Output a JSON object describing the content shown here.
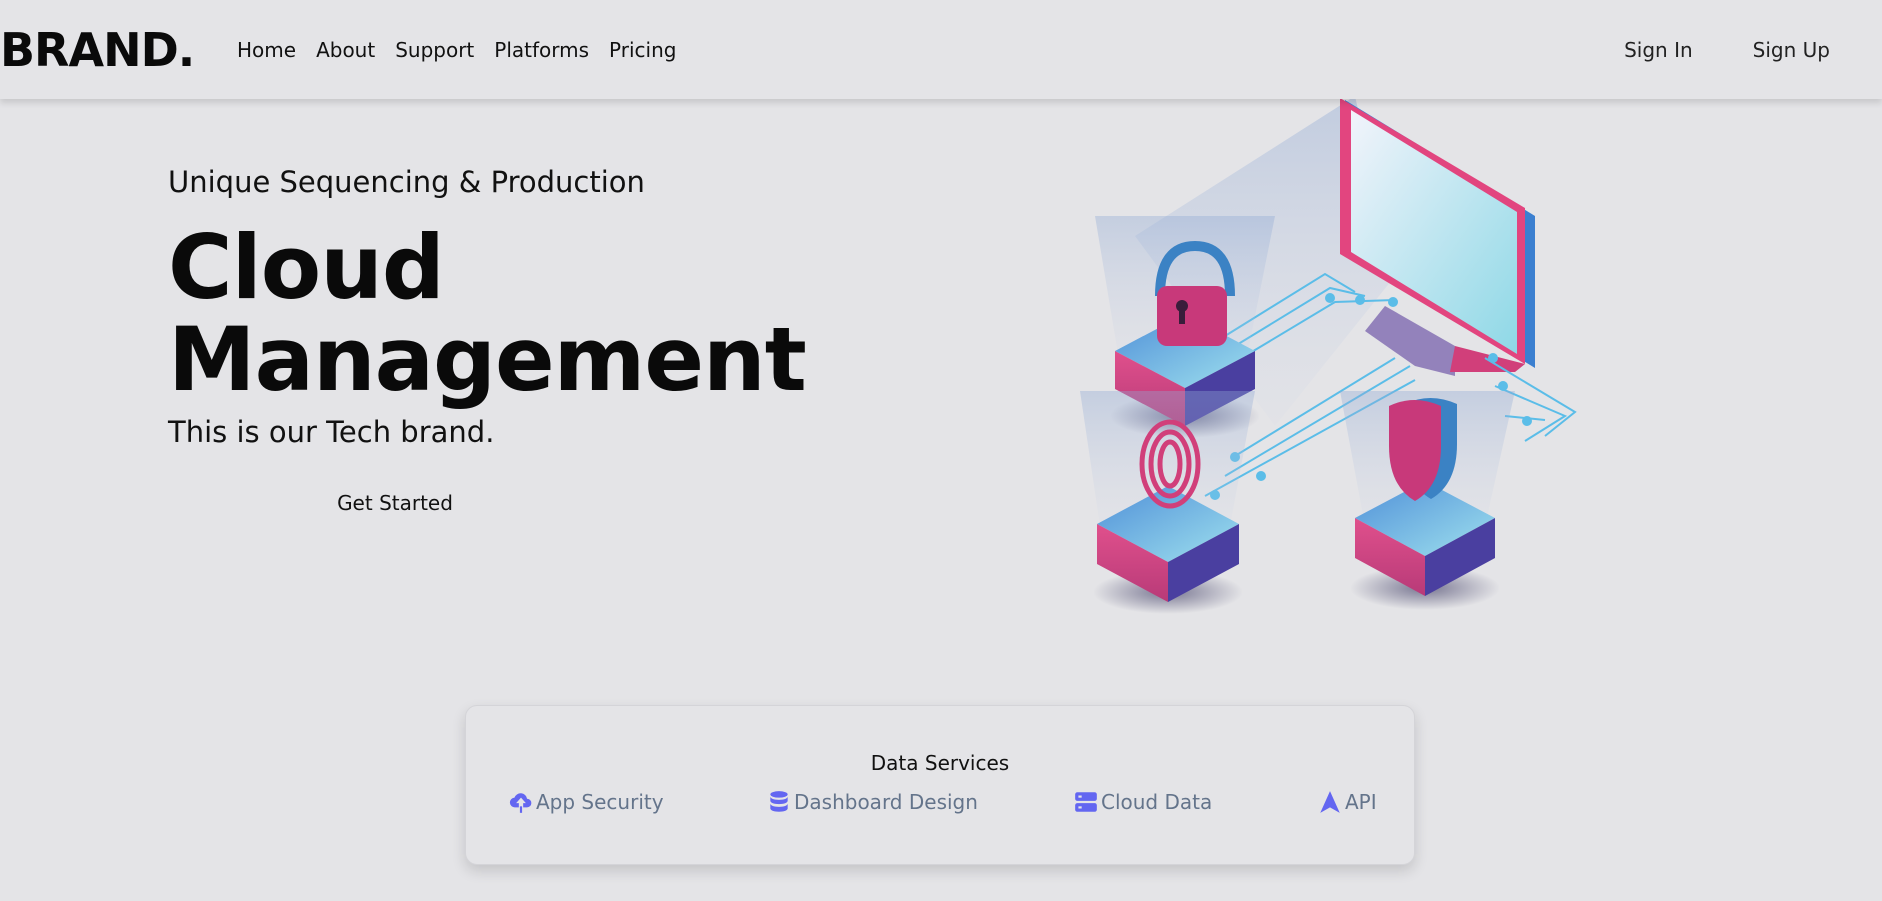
{
  "brand": "BRAND.",
  "nav": {
    "items": [
      {
        "label": "Home"
      },
      {
        "label": "About"
      },
      {
        "label": "Support"
      },
      {
        "label": "Platforms"
      },
      {
        "label": "Pricing"
      }
    ]
  },
  "auth": {
    "sign_in": "Sign In",
    "sign_up": "Sign Up"
  },
  "hero": {
    "eyebrow": "Unique Sequencing & Production",
    "headline_line1": "Cloud",
    "headline_line2": "Management",
    "tagline": "This is our Tech brand.",
    "cta": "Get Started"
  },
  "services": {
    "title": "Data Services",
    "items": [
      {
        "label": "App Security",
        "icon": "cloud-upload-icon"
      },
      {
        "label": "Dashboard Design",
        "icon": "database-icon"
      },
      {
        "label": "Cloud Data",
        "icon": "server-icon"
      },
      {
        "label": "API",
        "icon": "navigation-arrow-icon"
      }
    ]
  },
  "colors": {
    "background": "#e4e4e7",
    "accent_icon": "#6366f1",
    "service_text": "#64748b",
    "pink": "#e2457f",
    "blue": "#3b82c4"
  }
}
